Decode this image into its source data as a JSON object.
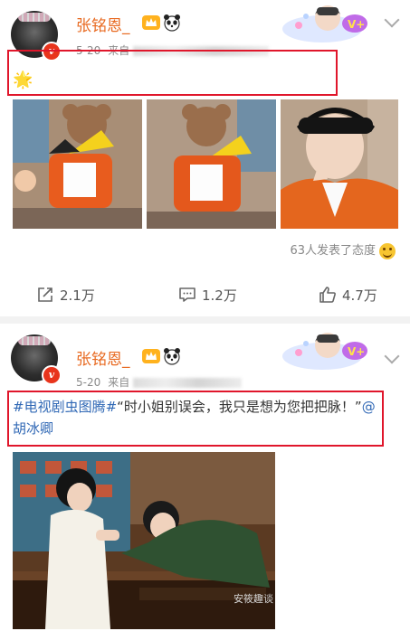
{
  "post1": {
    "username": "张铭恩_",
    "time": "5-20",
    "source_prefix": "来自",
    "body_emoji": "🌟",
    "reactions_text": "63人发表了态度",
    "actions": {
      "repost": "2.1万",
      "comment": "1.2万",
      "like": "4.7万"
    }
  },
  "post2": {
    "username": "张铭恩_",
    "time": "5-20",
    "source_prefix": "来自",
    "text_hashtag": "#电视剧虫图腾#",
    "text_quote": "“时小姐别误会，我只是想为您把把脉！”",
    "text_mention": "@胡冰卿"
  },
  "watermark": "安筱趣谈",
  "colors": {
    "username": "#e86a21",
    "link": "#3068b5",
    "highlight_box": "#e0162b",
    "verified_badge": "#e8341c"
  }
}
